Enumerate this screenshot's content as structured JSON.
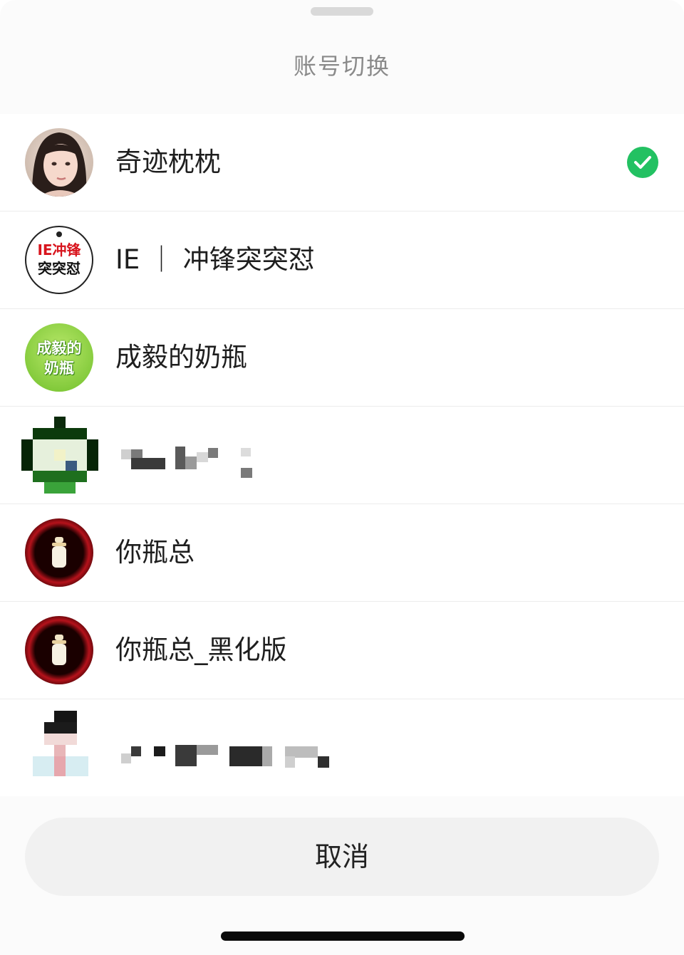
{
  "sheet": {
    "title": "账号切换",
    "cancel_label": "取消"
  },
  "accounts": [
    {
      "name": "奇迹枕枕",
      "selected": true,
      "avatar": "photo-avatar"
    },
    {
      "name": "IE ｜ 冲锋突突怼",
      "selected": false,
      "avatar": "ie-badge-avatar",
      "avatar_text": [
        "IE冲锋",
        "突突怼"
      ]
    },
    {
      "name": "成毅的奶瓶",
      "selected": false,
      "avatar": "green-badge-avatar",
      "avatar_text": [
        "成毅的",
        "奶瓶"
      ]
    },
    {
      "name": "",
      "selected": false,
      "avatar": "pixelated-avatar",
      "censored": true
    },
    {
      "name": "你瓶总",
      "selected": false,
      "avatar": "bottle-avatar"
    },
    {
      "name": "你瓶总_黑化版",
      "selected": false,
      "avatar": "bottle-avatar"
    },
    {
      "name": "",
      "selected": false,
      "avatar": "pixelated-avatar",
      "censored": true
    }
  ],
  "colors": {
    "check_green": "#23c162",
    "badge_red": "#d8141d",
    "bottle_ring": "#c8141c"
  },
  "icons": {
    "selected": "check-circle-icon",
    "handle": "drag-handle-icon"
  }
}
